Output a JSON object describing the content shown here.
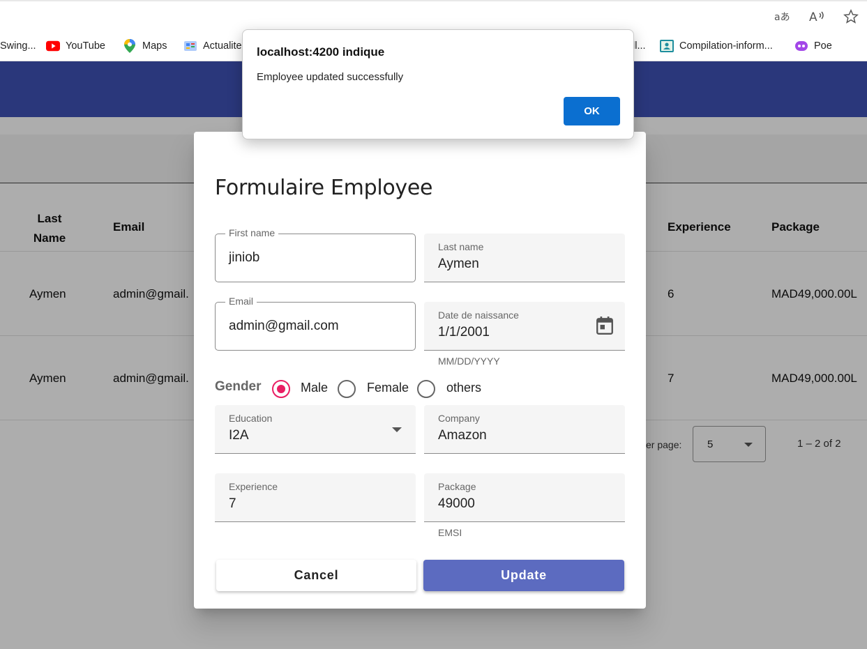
{
  "browser": {
    "toolbar_icons": [
      "translate-icon",
      "read-aloud-icon",
      "favorite-star-icon"
    ],
    "bookmarks": [
      {
        "label": "Swing...",
        "icon": "none"
      },
      {
        "label": "YouTube",
        "icon": "youtube-icon"
      },
      {
        "label": "Maps",
        "icon": "maps-pin-icon"
      },
      {
        "label": "Actualite",
        "icon": "news-icon"
      },
      {
        "label": "ll...",
        "icon": "none"
      },
      {
        "label": "Compilation-inform...",
        "icon": "classroom-icon"
      },
      {
        "label": "Poe",
        "icon": "poe-icon"
      }
    ]
  },
  "table": {
    "headers": {
      "last_name": "Last\nName",
      "email": "Email",
      "experience": "Experience",
      "package": "Package"
    },
    "rows": [
      {
        "last_name": "Aymen",
        "email": "admin@gmail.",
        "experience": "6",
        "package": "MAD49,000.00L"
      },
      {
        "last_name": "Aymen",
        "email": "admin@gmail.",
        "experience": "7",
        "package": "MAD49,000.00L"
      }
    ],
    "paginator": {
      "label": "er page:",
      "page_size": "5",
      "range": "1 – 2 of 2"
    }
  },
  "dialog": {
    "title": "Formulaire Employee",
    "first_name": {
      "label": "First name",
      "value": "jiniob"
    },
    "last_name": {
      "label": "Last name",
      "value": "Aymen"
    },
    "email": {
      "label": "Email",
      "value": "admin@gmail.com"
    },
    "dob": {
      "label": "Date de naissance",
      "value": "1/1/2001",
      "hint": "MM/DD/YYYY"
    },
    "gender": {
      "label": "Gender",
      "options": [
        "Male",
        "Female",
        "others"
      ],
      "selected": "Male"
    },
    "education": {
      "label": "Education",
      "value": "I2A"
    },
    "company": {
      "label": "Company",
      "value": "Amazon"
    },
    "experience": {
      "label": "Experience",
      "value": "7"
    },
    "package": {
      "label": "Package",
      "value": "49000",
      "hint": "EMSI"
    },
    "cancel_label": "Cancel",
    "update_label": "Update"
  },
  "alert": {
    "title": "localhost:4200 indique",
    "message": "Employee updated successfully",
    "ok_label": "OK"
  },
  "colors": {
    "app_toolbar": "#3f51b5",
    "update_button": "#5c6bc0",
    "radio_accent": "#e91e63",
    "alert_ok": "#0b6fd0"
  }
}
